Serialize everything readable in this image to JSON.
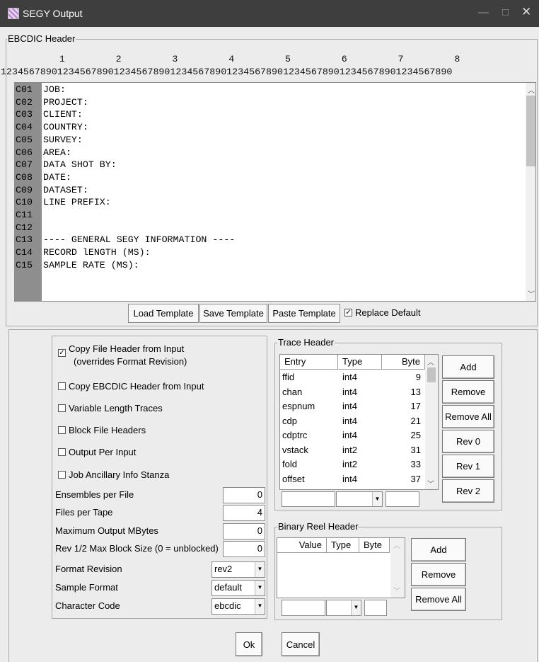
{
  "window": {
    "title": "SEGY Output",
    "minimize": "—",
    "maximize": "□",
    "close": "✕"
  },
  "ebcdic": {
    "legend": "EBCDIC Header",
    "ruler_tens": "         1         2         3         4         5         6         7         8",
    "ruler_units": "12345678901234567890123456789012345678901234567890123456789012345678901234567890",
    "lines": [
      {
        "num": "C01",
        "text": "JOB:"
      },
      {
        "num": "C02",
        "text": "PROJECT:"
      },
      {
        "num": "C03",
        "text": "CLIENT:"
      },
      {
        "num": "C04",
        "text": "COUNTRY:"
      },
      {
        "num": "C05",
        "text": "SURVEY:"
      },
      {
        "num": "C06",
        "text": "AREA:"
      },
      {
        "num": "C07",
        "text": "DATA SHOT BY:"
      },
      {
        "num": "C08",
        "text": "DATE:"
      },
      {
        "num": "C09",
        "text": "DATASET:"
      },
      {
        "num": "C10",
        "text": "LINE PREFIX:"
      },
      {
        "num": "C11",
        "text": ""
      },
      {
        "num": "C12",
        "text": ""
      },
      {
        "num": "C13",
        "text": "---- GENERAL SEGY INFORMATION ----"
      },
      {
        "num": "C14",
        "text": "RECORD lENGTH (MS):"
      },
      {
        "num": "C15",
        "text": "SAMPLE RATE (MS):"
      }
    ],
    "buttons": {
      "load": "Load Template",
      "save": "Save Template",
      "paste": "Paste Template"
    },
    "replace_default": {
      "label": "Replace Default",
      "checked": true
    }
  },
  "options": {
    "copy_file_header": {
      "label1": "Copy File Header from Input",
      "label2": "(overrides Format Revision)",
      "checked": true
    },
    "checkboxes": [
      {
        "label": "Copy EBCDIC Header from Input",
        "checked": false
      },
      {
        "label": "Variable Length Traces",
        "checked": false
      },
      {
        "label": "Block File Headers",
        "checked": false
      },
      {
        "label": "Output Per Input",
        "checked": false
      },
      {
        "label": "Job Ancillary Info Stanza",
        "checked": false
      }
    ],
    "fields": [
      {
        "label": "Ensembles per File",
        "value": "0"
      },
      {
        "label": "Files per Tape",
        "value": "4"
      },
      {
        "label": "Maximum Output MBytes",
        "value": "0"
      },
      {
        "label": "Rev 1/2 Max Block Size (0 = unblocked)",
        "value": "0"
      }
    ],
    "selects": [
      {
        "label": "Format Revision",
        "value": "rev2"
      },
      {
        "label": "Sample Format",
        "value": "default"
      },
      {
        "label": "Character Code",
        "value": "ebcdic"
      }
    ]
  },
  "trace_header": {
    "legend": "Trace Header",
    "columns": [
      "Entry",
      "Type",
      "Byte"
    ],
    "rows": [
      [
        "ffid",
        "int4",
        "9"
      ],
      [
        "chan",
        "int4",
        "13"
      ],
      [
        "espnum",
        "int4",
        "17"
      ],
      [
        "cdp",
        "int4",
        "21"
      ],
      [
        "cdptrc",
        "int4",
        "25"
      ],
      [
        "vstack",
        "int2",
        "31"
      ],
      [
        "fold",
        "int2",
        "33"
      ],
      [
        "offset",
        "int4",
        "37"
      ]
    ],
    "buttons": [
      "Add",
      "Remove",
      "Remove All",
      "Rev 0",
      "Rev 1",
      "Rev 2"
    ]
  },
  "binary_reel_header": {
    "legend": "Binary Reel Header",
    "columns": [
      "Value",
      "Type",
      "Byte"
    ],
    "buttons": [
      "Add",
      "Remove",
      "Remove All"
    ]
  },
  "footer": {
    "ok": "Ok",
    "cancel": "Cancel"
  }
}
